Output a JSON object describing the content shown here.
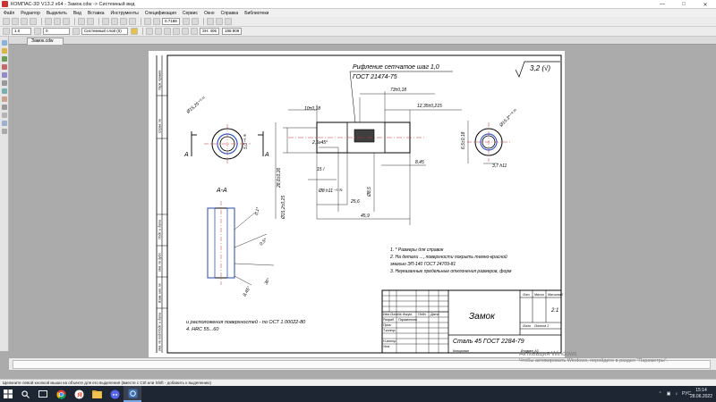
{
  "window": {
    "title": "КОМПАС-3D V13.2  x64 - Замок.cdw -> Системный вид"
  },
  "menu": [
    "Файл",
    "Редактор",
    "Выделить",
    "Вид",
    "Вставка",
    "Инструменты",
    "Спецификация",
    "Сервис",
    "Окно",
    "Справка",
    "Библиотеки"
  ],
  "toolbar": {
    "scale": "1.0",
    "zero": "0",
    "layer": "Системный слой (0)",
    "zoom": "0.7188",
    "step": "ЗН: 406",
    "zoom2": "188.909"
  },
  "tabs": [
    {
      "label": "Замок.cdw"
    }
  ],
  "drawing": {
    "header_note": "Рифление сетчатое шаг 1,0",
    "header_note2": "ГОСТ 21474-75",
    "roughness": "3,2 (√)",
    "section_label": "А-А",
    "cut_mark_a1": "А",
    "cut_mark_a2": "А",
    "dims": {
      "d_odot": "Ø15,25⁺⁰·¹¹",
      "d_left_v": "5,0⁺⁰·⁰⁵",
      "d_10": "10±0,18",
      "d_chamfer": "2,5х45°",
      "d_15": "15 /",
      "d_8": "Ø8 h11⁻⁰·⁰⁹",
      "d_ovlen": "Ø8,5",
      "d_286": "28,6±0,26",
      "d_25": "Ø15,2±0,25",
      "d_256": "25,6",
      "d_459": "45,9",
      "d_73": "73±0,18",
      "d_12": "12,35±0,215",
      "d_845": "8,45",
      "d_r_v": "6,5±0,18",
      "d_right_ring": "Ø15,3*⁺⁰·²⁵",
      "d_37": "3,7 h11",
      "d_sec_04": "0,1*",
      "d_sec_05": "0,5*",
      "d_sec_30": "30°",
      "d_sec_845": "8,45°",
      "d_sec_175": "1,75*"
    },
    "notes": [
      "1. * Размеры для справок",
      "2. На детали ..., поверхности покрыть темно-красной",
      "эмалью ЭП-140 ГОСТ 24709-81",
      "3. Неуказанные предельные отклонения размеров, форм"
    ],
    "notes_bottom": [
      "и расположения поверхностей - по ОСТ 1.00022-80",
      "4. HRC 55...60"
    ],
    "title_block": {
      "name": "Замок",
      "material": "Сталь 45 ГОСТ 2284-79",
      "lit": "Лит.",
      "mass": "Масса",
      "scale_label": "Масштаб",
      "scale_value": "2:1",
      "sheet": "Лист",
      "sheets": "Листов 1",
      "izm": "Изм.",
      "list": "Лист",
      "ndoc": "№ докум.",
      "podp": "Подп.",
      "data": "Дата",
      "razrab": "Разраб.",
      "author": "Парамонова",
      "prov": "Пров.",
      "tkontr": "Т.контр.",
      "nkontr": "Н.контр.",
      "utv": "Утв.",
      "copied": "Копировал",
      "format": "Формат  А3"
    },
    "side_labels": [
      "Перв. примен.",
      "Справ. №",
      "Подп. и дата",
      "Инв. № дубл.",
      "Взам. инв. №",
      "Подп. и дата",
      "Инв. № подл."
    ]
  },
  "watermark": {
    "line1": "Активация Windows",
    "line2": "Чтобы активировать Windows, перейдите в раздел \"Параметры\"."
  },
  "status": "Щелкните левой кнопкой мыши на объекте для его выделения (вместе с Ctrl или Shift - добавить к выделению)",
  "taskbar": {
    "lang": "РУС",
    "time": "15:14",
    "date": "28.06.2022"
  },
  "icons": [
    "kompas-app-icon",
    "minimize-icon",
    "maximize-icon",
    "close-icon",
    "windows-start-icon",
    "search-icon",
    "task-view-icon",
    "chrome-icon",
    "yandex-icon",
    "explorer-icon",
    "discord-icon",
    "kompas-task-icon"
  ]
}
